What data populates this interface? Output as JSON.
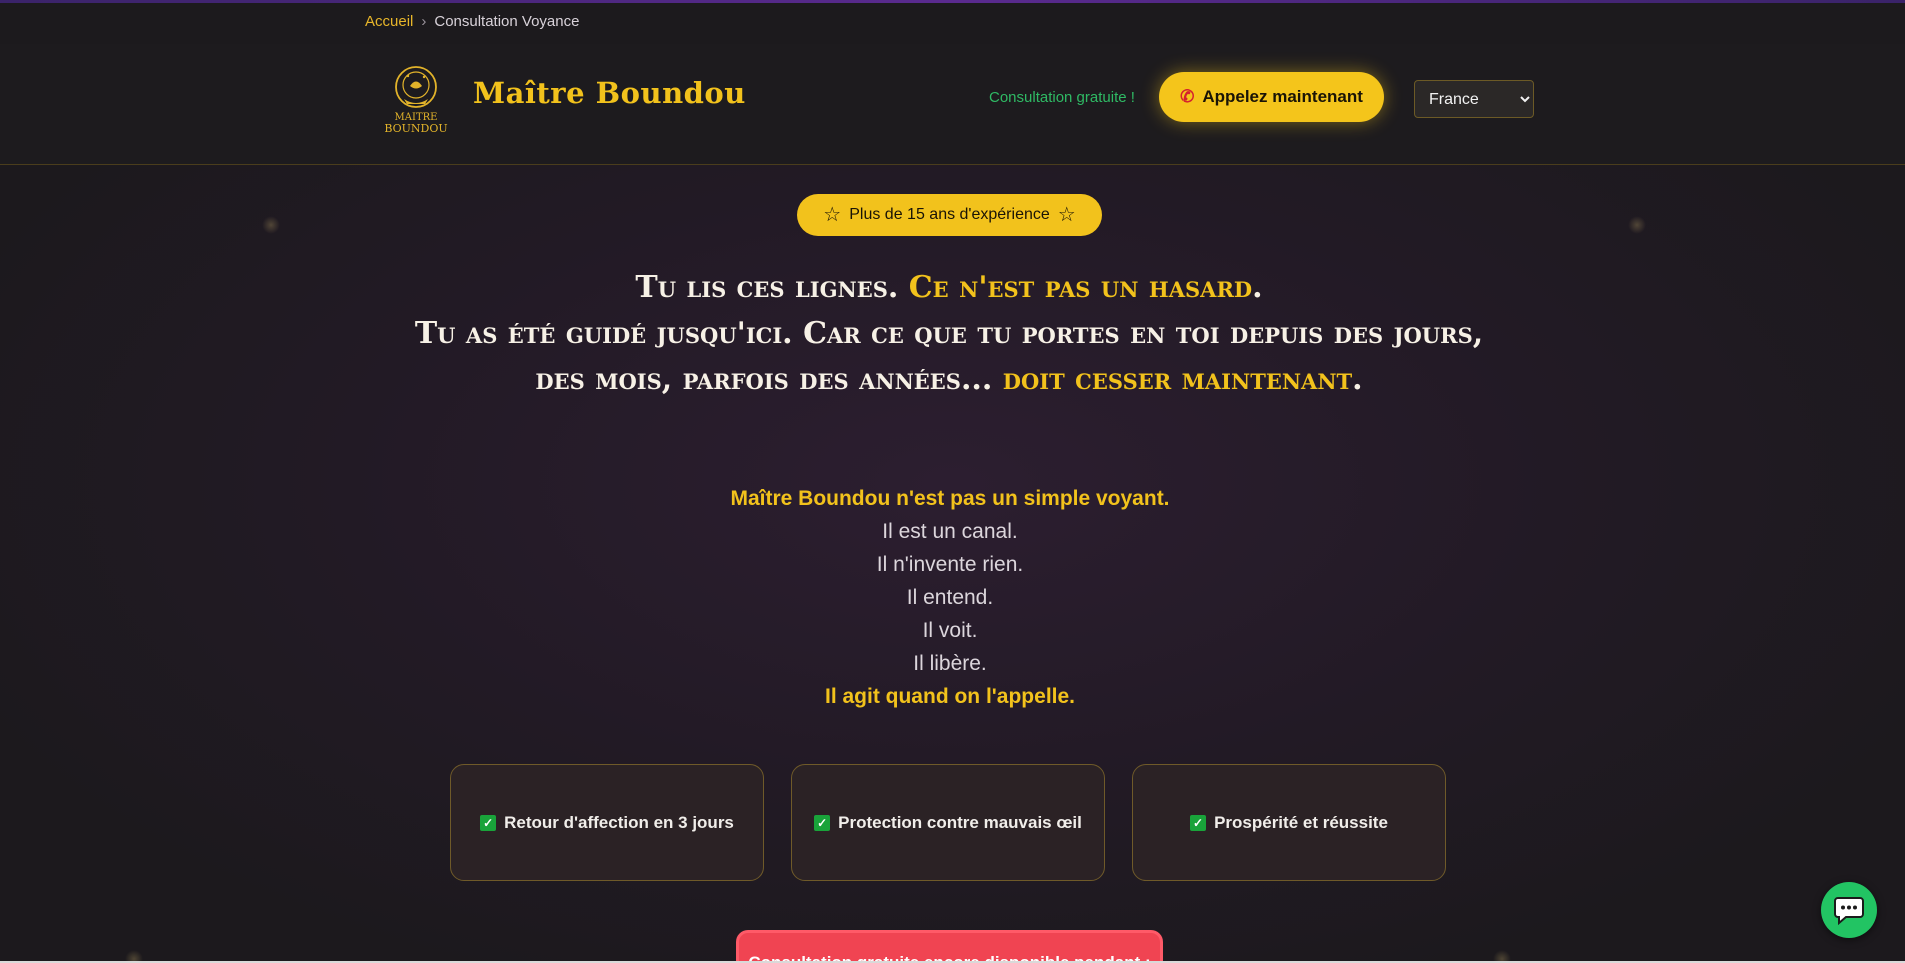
{
  "breadcrumb": {
    "home": "Accueil",
    "separator": "›",
    "current": "Consultation Voyance"
  },
  "header": {
    "logo_text_line1": "MAITRE",
    "logo_text_line2": "BOUNDOU",
    "brand": "Maître Boundou",
    "free_consultation": "Consultation gratuite !",
    "call_button": "Appelez maintenant",
    "country_select": {
      "selected": "France",
      "options": [
        "France"
      ]
    }
  },
  "hero": {
    "badge": "Plus de 15 ans d'expérience",
    "headline": {
      "line1_white": "Tu lis ces lignes. ",
      "line1_gold": "Ce n'est pas un hasard",
      "line1_end": ".",
      "line2_white": "Tu as été guidé jusqu'ici. Car ce que tu portes en toi depuis des jours, des mois, parfois des années... ",
      "line2_gold": "doit cesser maintenant",
      "line2_end": "."
    },
    "intro": [
      {
        "text": "Maître Boundou n'est pas un simple voyant.",
        "highlight": true
      },
      {
        "text": "Il est un canal.",
        "highlight": false
      },
      {
        "text": "Il n'invente rien.",
        "highlight": false
      },
      {
        "text": "Il entend.",
        "highlight": false
      },
      {
        "text": "Il voit.",
        "highlight": false
      },
      {
        "text": "Il libère.",
        "highlight": false
      },
      {
        "text": "Il agit quand on l'appelle.",
        "highlight": true
      }
    ],
    "features": [
      "Retour d'affection en 3 jours",
      "Protection contre mauvais œil",
      "Prospérité et réussite"
    ],
    "countdown_text": "Consultation gratuite encore disponible pendant :"
  },
  "colors": {
    "gold": "#f2c21c",
    "green": "#2fb964",
    "background": "#1c1a1d",
    "alert_red": "#f04452",
    "chat_green": "#22c463"
  },
  "icons": {
    "logo": "crystal-ball-logo",
    "phone": "phone-icon",
    "star": "star-icon",
    "check": "check-icon",
    "chat": "chat-bubble-icon"
  }
}
